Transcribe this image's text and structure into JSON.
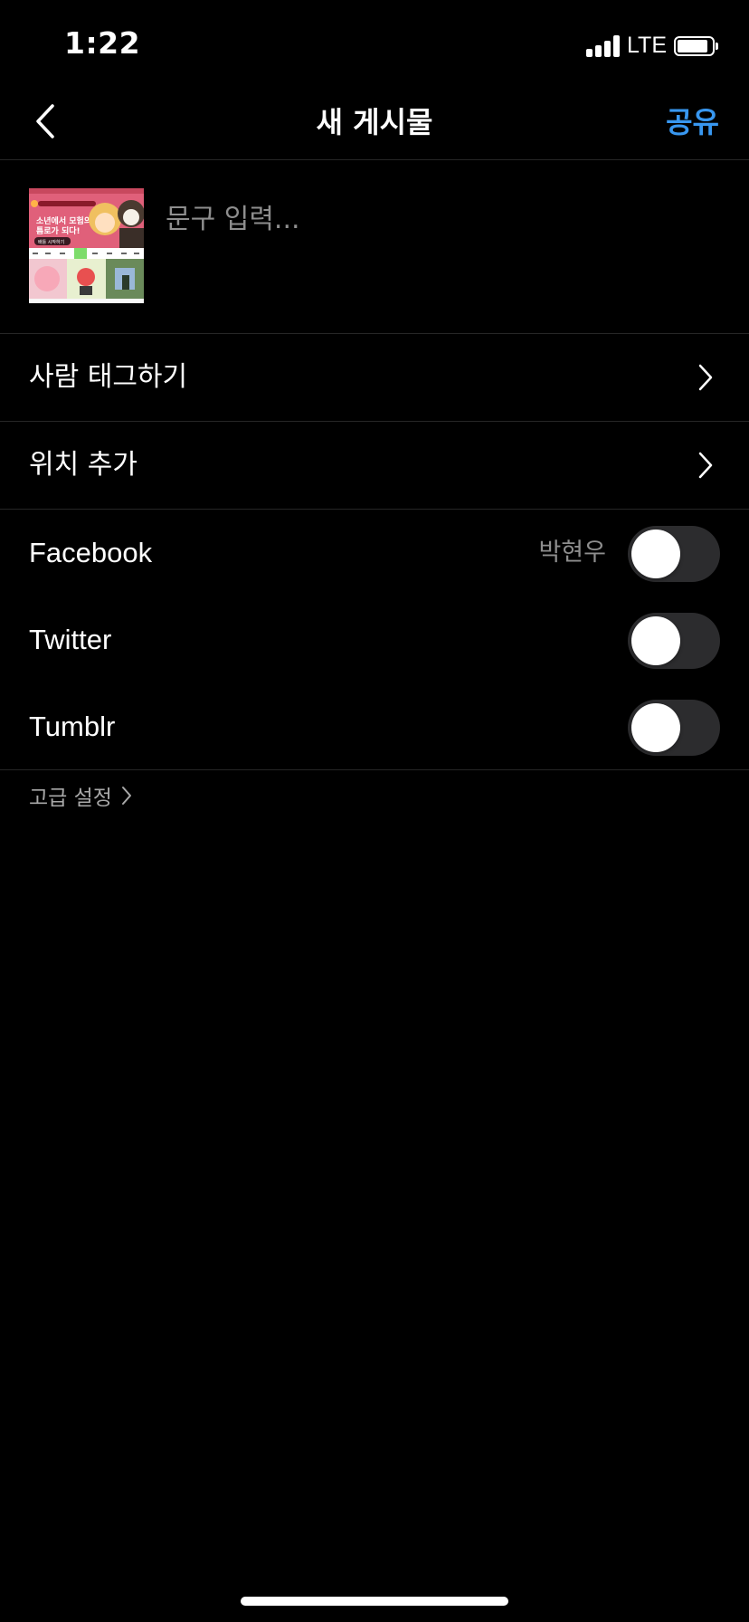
{
  "status_bar": {
    "time": "1:22",
    "network": "LTE",
    "signal_bars": 4,
    "battery_level": 0.9
  },
  "nav": {
    "back_icon": "chevron-left-icon",
    "title": "새 게시물",
    "share_label": "공유",
    "accent_color": "#3897f0"
  },
  "caption": {
    "placeholder": "문구 입력...",
    "value": ""
  },
  "thumbnail": {
    "banner_text_line1": "소년에서 모험의",
    "banner_text_line2": "틈로가 되다!",
    "button_text": "배틀 시작하기"
  },
  "options": [
    {
      "label": "사람 태그하기",
      "icon": "chevron-right-icon"
    },
    {
      "label": "위치 추가",
      "icon": "chevron-right-icon"
    }
  ],
  "share_targets": [
    {
      "label": "Facebook",
      "account": "박현우",
      "enabled": false
    },
    {
      "label": "Twitter",
      "account": "",
      "enabled": false
    },
    {
      "label": "Tumblr",
      "account": "",
      "enabled": false
    }
  ],
  "advanced": {
    "label": "고급 설정",
    "icon": "chevron-right-icon"
  },
  "colors": {
    "background": "#000000",
    "divider": "#262626",
    "toggle_off": "#2c2c2e",
    "muted_text": "#8e8e8e"
  }
}
